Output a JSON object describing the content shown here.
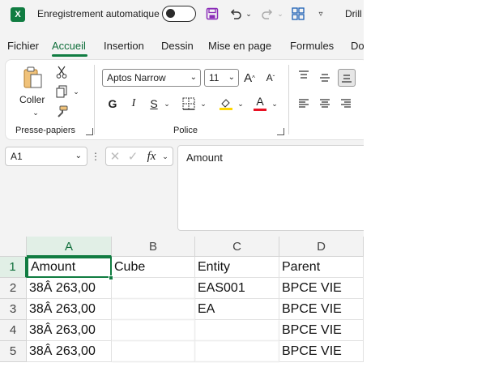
{
  "titlebar": {
    "app_icon_letter": "X",
    "autosave_label": "Enregistrement automatique",
    "doc_title": "Drill"
  },
  "tabs": [
    "Fichier",
    "Accueil",
    "Insertion",
    "Dessin",
    "Mise en page",
    "Formules",
    "Do"
  ],
  "active_tab": "Accueil",
  "ribbon": {
    "clipboard": {
      "paste_label": "Coller",
      "group_label": "Presse-papiers"
    },
    "font": {
      "font_name": "Aptos Narrow",
      "font_size": "11",
      "bold": "G",
      "italic": "I",
      "underline": "S",
      "grow": "A",
      "shrink": "A",
      "font_color_letter": "A",
      "group_label": "Police",
      "highlight_color": "#ffd700",
      "font_color": "#e81123"
    }
  },
  "formula_bar": {
    "name_box": "A1",
    "fx": "fx",
    "content": "Amount"
  },
  "sheet": {
    "columns": [
      "A",
      "B",
      "C",
      "D"
    ],
    "rows": [
      "1",
      "2",
      "3",
      "4",
      "5"
    ],
    "headers": [
      "Amount",
      "Cube",
      "Entity",
      "Parent"
    ],
    "data": [
      [
        "38Â 263,00",
        "",
        "EAS001",
        "BPCE VIE"
      ],
      [
        "38Â 263,00",
        "",
        "EA",
        "BPCE VIE"
      ],
      [
        "38Â 263,00",
        "",
        "",
        "BPCE VIE"
      ],
      [
        "38Â 263,00",
        "",
        "",
        "BPCE VIE"
      ]
    ]
  },
  "colors": {
    "accent": "#107c41"
  }
}
